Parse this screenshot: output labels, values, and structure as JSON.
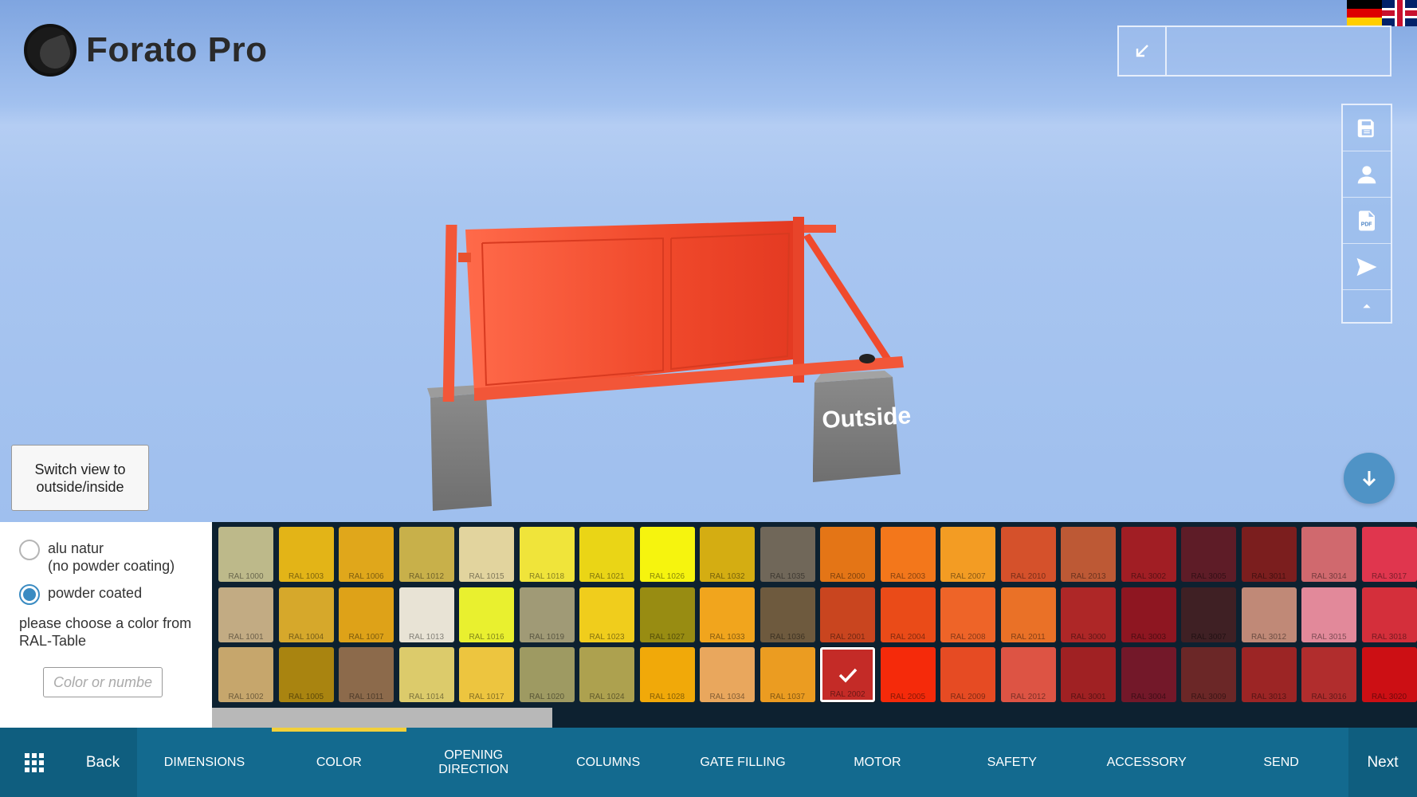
{
  "app": {
    "name": "Forato Pro"
  },
  "flags": [
    "german-flag-icon",
    "uk-flag-icon"
  ],
  "viewport": {
    "label_outside": "Outside",
    "switch_view_label": "Switch view to outside/inside",
    "gate_color": "#f0492b"
  },
  "toolbar": {
    "icons": [
      "save-icon",
      "user-icon",
      "pdf-icon",
      "send-icon",
      "caret-up-icon"
    ]
  },
  "coating": {
    "options": [
      {
        "label": "alu natur",
        "sublabel": "(no powder coating)",
        "selected": false
      },
      {
        "label": "powder coated",
        "selected": true
      }
    ],
    "hint": "please choose a color from RAL-Table",
    "input_placeholder": "Color or number"
  },
  "ral_table": {
    "selected": "RAL 2002",
    "columns": [
      [
        {
          "code": "RAL 1000",
          "color": "#bdb98a"
        },
        {
          "code": "RAL 1001",
          "color": "#c2ab83"
        },
        {
          "code": "RAL 1002",
          "color": "#c6a66c"
        }
      ],
      [
        {
          "code": "RAL 1003",
          "color": "#e3b417"
        },
        {
          "code": "RAL 1004",
          "color": "#d6a82b"
        },
        {
          "code": "RAL 1005",
          "color": "#a98410"
        }
      ],
      [
        {
          "code": "RAL 1006",
          "color": "#e0a71b"
        },
        {
          "code": "RAL 1007",
          "color": "#dea218"
        },
        {
          "code": "RAL 1011",
          "color": "#8c6a4b"
        }
      ],
      [
        {
          "code": "RAL 1012",
          "color": "#c8b04a"
        },
        {
          "code": "RAL 1013",
          "color": "#e8e3d5"
        },
        {
          "code": "RAL 1014",
          "color": "#dccb6b"
        }
      ],
      [
        {
          "code": "RAL 1015",
          "color": "#e2d49e"
        },
        {
          "code": "RAL 1016",
          "color": "#e9f02f"
        },
        {
          "code": "RAL 1017",
          "color": "#edc53f"
        }
      ],
      [
        {
          "code": "RAL 1018",
          "color": "#f0e43a"
        },
        {
          "code": "RAL 1019",
          "color": "#a09a76"
        },
        {
          "code": "RAL 1020",
          "color": "#9e9a62"
        }
      ],
      [
        {
          "code": "RAL 1021",
          "color": "#ead516"
        },
        {
          "code": "RAL 1023",
          "color": "#f0cd1c"
        },
        {
          "code": "RAL 1024",
          "color": "#ada14f"
        }
      ],
      [
        {
          "code": "RAL 1026",
          "color": "#f6f40e"
        },
        {
          "code": "RAL 1027",
          "color": "#988c12"
        },
        {
          "code": "RAL 1028",
          "color": "#f1a909"
        }
      ],
      [
        {
          "code": "RAL 1032",
          "color": "#d4ad12"
        },
        {
          "code": "RAL 1033",
          "color": "#f1a51d"
        },
        {
          "code": "RAL 1034",
          "color": "#e9a75d"
        }
      ],
      [
        {
          "code": "RAL 1035",
          "color": "#706759"
        },
        {
          "code": "RAL 1036",
          "color": "#6e5a3e"
        },
        {
          "code": "RAL 1037",
          "color": "#eb9c21"
        }
      ],
      [
        {
          "code": "RAL 2000",
          "color": "#e47516"
        },
        {
          "code": "RAL 2001",
          "color": "#c9451f"
        },
        {
          "code": "RAL 2002",
          "color": "#c42b27"
        }
      ],
      [
        {
          "code": "RAL 2003",
          "color": "#f3771b"
        },
        {
          "code": "RAL 2004",
          "color": "#ea4b18"
        },
        {
          "code": "RAL 2005",
          "color": "#f52a0a"
        }
      ],
      [
        {
          "code": "RAL 2007",
          "color": "#f39c23"
        },
        {
          "code": "RAL 2008",
          "color": "#ee6428"
        },
        {
          "code": "RAL 2009",
          "color": "#e64b23"
        }
      ],
      [
        {
          "code": "RAL 2010",
          "color": "#d5512b"
        },
        {
          "code": "RAL 2011",
          "color": "#ea7127"
        },
        {
          "code": "RAL 2012",
          "color": "#dd5444"
        }
      ],
      [
        {
          "code": "RAL 2013",
          "color": "#bd5935"
        },
        {
          "code": "RAL 3000",
          "color": "#ae2727"
        },
        {
          "code": "RAL 3001",
          "color": "#a02123"
        }
      ],
      [
        {
          "code": "RAL 3002",
          "color": "#a11e24"
        },
        {
          "code": "RAL 3003",
          "color": "#8e1621"
        },
        {
          "code": "RAL 3004",
          "color": "#731829"
        }
      ],
      [
        {
          "code": "RAL 3005",
          "color": "#5e1c27"
        },
        {
          "code": "RAL 3007",
          "color": "#3f2024"
        },
        {
          "code": "RAL 3009",
          "color": "#6b2727"
        }
      ],
      [
        {
          "code": "RAL 3011",
          "color": "#7b1e1e"
        },
        {
          "code": "RAL 3012",
          "color": "#c08977"
        },
        {
          "code": "RAL 3013",
          "color": "#9c2525"
        }
      ],
      [
        {
          "code": "RAL 3014",
          "color": "#d0696e"
        },
        {
          "code": "RAL 3015",
          "color": "#e2899a"
        },
        {
          "code": "RAL 3016",
          "color": "#b12d2d"
        }
      ],
      [
        {
          "code": "RAL 3017",
          "color": "#e0364e"
        },
        {
          "code": "RAL 3018",
          "color": "#d42f3b"
        },
        {
          "code": "RAL 3020",
          "color": "#cc0f14"
        }
      ]
    ]
  },
  "nav": {
    "back": "Back",
    "next": "Next",
    "active_tab": "COLOR",
    "tabs": [
      "DIMENSIONS",
      "COLOR",
      "OPENING DIRECTION",
      "COLUMNS",
      "GATE FILLING",
      "MOTOR",
      "SAFETY",
      "ACCESSORY",
      "SEND"
    ]
  }
}
